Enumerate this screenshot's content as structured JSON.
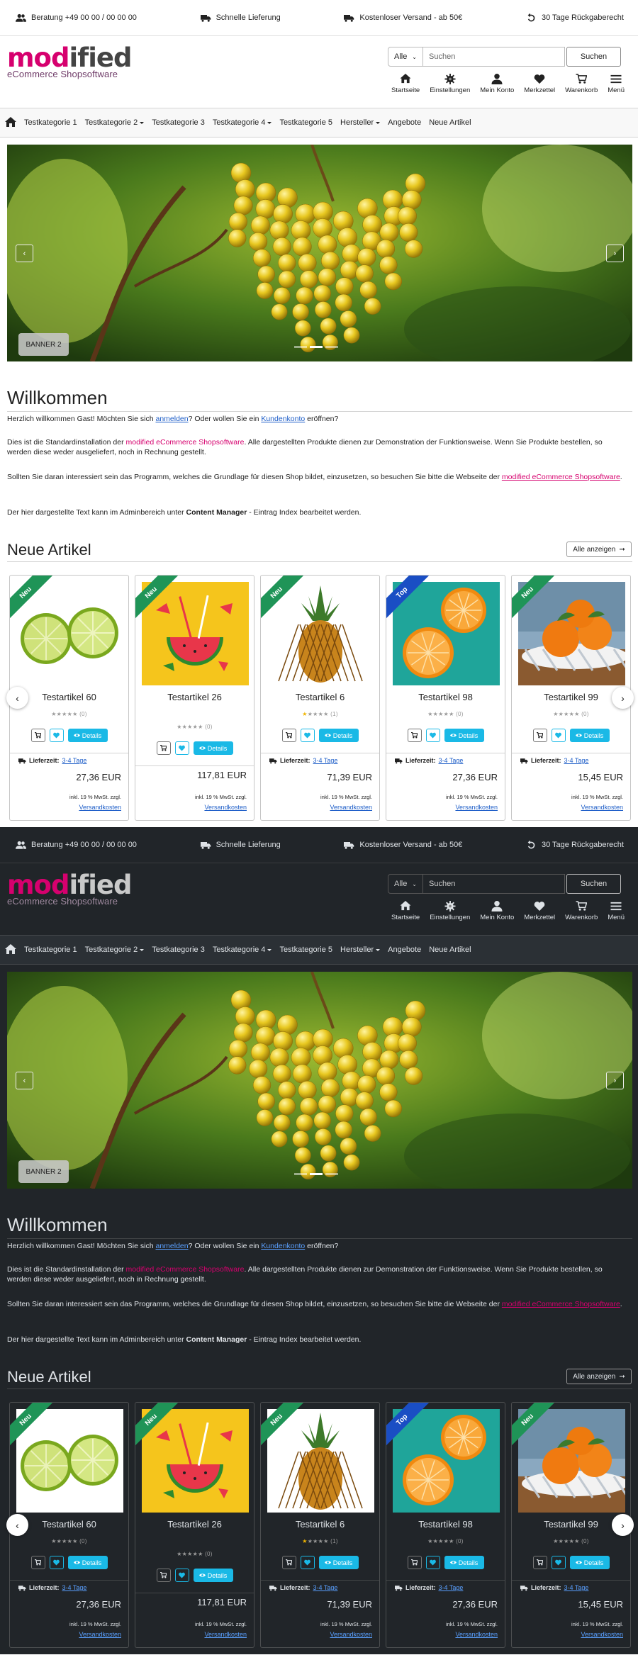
{
  "topbar": {
    "beratung": "Beratung +49 00 00 / 00 00 00",
    "lieferung": "Schnelle Lieferung",
    "versand": "Kostenloser Versand - ab 50€",
    "rueckgabe": "30 Tage Rückgaberecht"
  },
  "logo": {
    "part1": "mod",
    "part2": "ified",
    "subtitle": "eCommerce Shopsoftware"
  },
  "search": {
    "category": "Alle",
    "placeholder": "Suchen",
    "button": "Suchen"
  },
  "nav": [
    {
      "label": "Startseite",
      "icon": "home-icon"
    },
    {
      "label": "Einstellungen",
      "icon": "gear-icon"
    },
    {
      "label": "Mein Konto",
      "icon": "user-icon"
    },
    {
      "label": "Merkzettel",
      "icon": "heart-icon"
    },
    {
      "label": "Warenkorb",
      "icon": "cart-icon"
    },
    {
      "label": "Menü",
      "icon": "menu-icon"
    }
  ],
  "categories": [
    {
      "label": "Testkategorie 1",
      "dropdown": false
    },
    {
      "label": "Testkategorie 2",
      "dropdown": true
    },
    {
      "label": "Testkategorie 3",
      "dropdown": false
    },
    {
      "label": "Testkategorie 4",
      "dropdown": true
    },
    {
      "label": "Testkategorie 5",
      "dropdown": false
    },
    {
      "label": "Hersteller",
      "dropdown": true
    },
    {
      "label": "Angebote",
      "dropdown": false
    },
    {
      "label": "Neue Artikel",
      "dropdown": false
    }
  ],
  "banner": {
    "label": "BANNER 2"
  },
  "welcome": {
    "title": "Willkommen",
    "p1_a": "Herzlich willkommen Gast! Möchten Sie sich ",
    "p1_link1": "anmelden",
    "p1_b": "? Oder wollen Sie ein ",
    "p1_link2": "Kundenkonto",
    "p1_c": " eröffnen?",
    "p2_a": "Dies ist die Standardinstallation der ",
    "p2_brand": "modified eCommerce Shopsoftware",
    "p2_b": ". Alle dargestellten Produkte dienen zur Demonstration der Funktionsweise. Wenn Sie Produkte bestellen, so werden diese weder ausgeliefert, noch in Rechnung gestellt.",
    "p3_a": "Sollten Sie daran interessiert sein das Programm, welches die Grundlage für diesen Shop bildet, einzusetzen, so besuchen Sie bitte die Webseite der ",
    "p3_link": "modified eCommerce Shopsoftware",
    "p3_b": ".",
    "p4_a": "Der hier dargestellte Text kann im Adminbereich unter ",
    "p4_bold": "Content Manager",
    "p4_b": " - Eintrag Index bearbeitet werden."
  },
  "new_articles": {
    "title": "Neue Artikel",
    "show_all": "Alle anzeigen",
    "delivery_label": "Lieferzeit:",
    "delivery_value": "3-4 Tage",
    "tax_text": "inkl. 19 % MwSt. zzgl.",
    "shipping_link": "Versandkosten",
    "details": "Details",
    "products": [
      {
        "name": "Testartikel 60",
        "badge": "Neu",
        "stars_filled": 0,
        "reviews": "(0)",
        "price": "27,36 EUR",
        "image": "lime"
      },
      {
        "name": "Testartikel 26",
        "badge": "Neu",
        "stars_filled": 0,
        "reviews": "(0)",
        "price": "117,81 EUR",
        "image": "watermelon"
      },
      {
        "name": "Testartikel 6",
        "badge": "Neu",
        "stars_filled": 1,
        "reviews": "(1)",
        "price": "71,39 EUR",
        "image": "pineapple"
      },
      {
        "name": "Testartikel 98",
        "badge": "Top",
        "stars_filled": 0,
        "reviews": "(0)",
        "price": "27,36 EUR",
        "image": "orange"
      },
      {
        "name": "Testartikel 99",
        "badge": "Neu",
        "stars_filled": 0,
        "reviews": "(0)",
        "price": "15,45 EUR",
        "image": "tangerine"
      }
    ]
  },
  "colors": {
    "brand": "#d6006e",
    "details_button": "#1ab9e6",
    "badge_new": "#1f9457",
    "badge_top": "#1a4ec4",
    "dark_bg": "#212529"
  }
}
